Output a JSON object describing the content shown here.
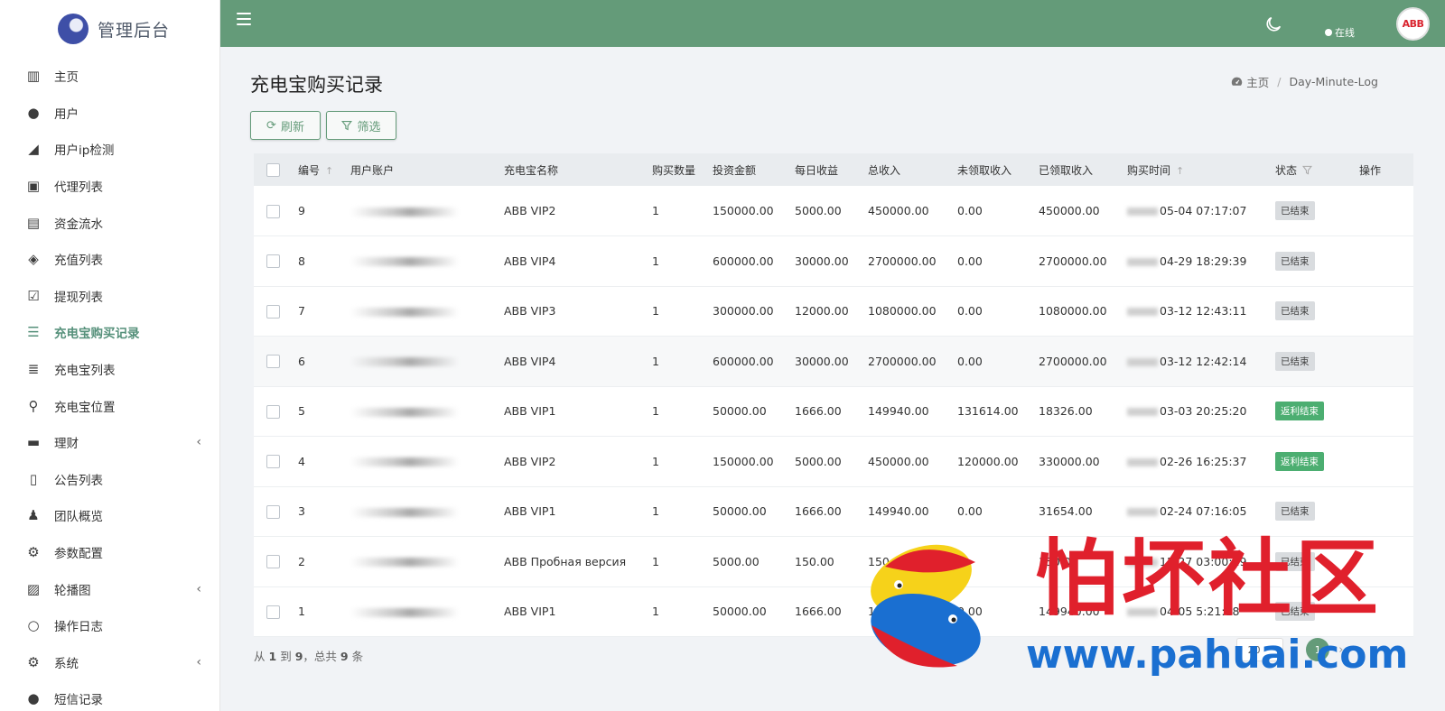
{
  "brand": {
    "title": "管理后台"
  },
  "sidebar": {
    "items": [
      {
        "label": "主页",
        "icon": "bar-chart-icon"
      },
      {
        "label": "用户",
        "icon": "user-icon"
      },
      {
        "label": "用户ip检测",
        "icon": "signal-icon"
      },
      {
        "label": "代理列表",
        "icon": "address-book-icon"
      },
      {
        "label": "资金流水",
        "icon": "money-icon"
      },
      {
        "label": "充值列表",
        "icon": "recharge-icon"
      },
      {
        "label": "提现列表",
        "icon": "check-square-icon"
      },
      {
        "label": "充电宝购买记录",
        "icon": "list-icon",
        "active": true
      },
      {
        "label": "充电宝列表",
        "icon": "indent-list-icon"
      },
      {
        "label": "充电宝位置",
        "icon": "map-marker-icon"
      },
      {
        "label": "理财",
        "icon": "archive-icon",
        "has_submenu": true
      },
      {
        "label": "公告列表",
        "icon": "file-text-icon"
      },
      {
        "label": "团队概览",
        "icon": "users-icon"
      },
      {
        "label": "参数配置",
        "icon": "cogs-icon"
      },
      {
        "label": "轮播图",
        "icon": "image-icon",
        "has_submenu": true
      },
      {
        "label": "操作日志",
        "icon": "circle-icon"
      },
      {
        "label": "系统",
        "icon": "gear-icon",
        "has_submenu": true
      },
      {
        "label": "短信记录",
        "icon": "comment-icon"
      }
    ]
  },
  "topbar": {
    "status_label": "在线",
    "avatar_text": "ABB",
    "theme_icon": "moon-icon"
  },
  "page": {
    "title": "充电宝购买记录",
    "breadcrumb": {
      "home": "主页",
      "current": "Day-Minute-Log"
    }
  },
  "toolbar": {
    "refresh_label": "刷新",
    "filter_label": "筛选"
  },
  "table": {
    "headers": {
      "id": "编号",
      "account": "用户账户",
      "name": "充电宝名称",
      "qty": "购买数量",
      "invest": "投资金额",
      "daily": "每日收益",
      "total": "总收入",
      "unclaimed": "未领取收入",
      "claimed": "已领取收入",
      "time": "购买时间",
      "status": "状态",
      "action": "操作"
    },
    "rows": [
      {
        "id": "9",
        "name": "ABB VIP2",
        "qty": "1",
        "invest": "150000.00",
        "daily": "5000.00",
        "total": "450000.00",
        "unclaimed": "0.00",
        "claimed": "450000.00",
        "time": "05-04 07:17:07",
        "status": "已结束",
        "status_type": "gray"
      },
      {
        "id": "8",
        "name": "ABB VIP4",
        "qty": "1",
        "invest": "600000.00",
        "daily": "30000.00",
        "total": "2700000.00",
        "unclaimed": "0.00",
        "claimed": "2700000.00",
        "time": "04-29 18:29:39",
        "status": "已结束",
        "status_type": "gray"
      },
      {
        "id": "7",
        "name": "ABB VIP3",
        "qty": "1",
        "invest": "300000.00",
        "daily": "12000.00",
        "total": "1080000.00",
        "unclaimed": "0.00",
        "claimed": "1080000.00",
        "time": "03-12 12:43:11",
        "status": "已结束",
        "status_type": "gray"
      },
      {
        "id": "6",
        "name": "ABB VIP4",
        "qty": "1",
        "invest": "600000.00",
        "daily": "30000.00",
        "total": "2700000.00",
        "unclaimed": "0.00",
        "claimed": "2700000.00",
        "time": "03-12 12:42:14",
        "status": "已结束",
        "status_type": "gray"
      },
      {
        "id": "5",
        "name": "ABB VIP1",
        "qty": "1",
        "invest": "50000.00",
        "daily": "1666.00",
        "total": "149940.00",
        "unclaimed": "131614.00",
        "claimed": "18326.00",
        "time": "03-03 20:25:20",
        "status": "返利结束",
        "status_type": "green"
      },
      {
        "id": "4",
        "name": "ABB VIP2",
        "qty": "1",
        "invest": "150000.00",
        "daily": "5000.00",
        "total": "450000.00",
        "unclaimed": "120000.00",
        "claimed": "330000.00",
        "time": "02-26 16:25:37",
        "status": "返利结束",
        "status_type": "green"
      },
      {
        "id": "3",
        "name": "ABB VIP1",
        "qty": "1",
        "invest": "50000.00",
        "daily": "1666.00",
        "total": "149940.00",
        "unclaimed": "0.00",
        "claimed": "31654.00",
        "time": "02-24 07:16:05",
        "status": "已结束",
        "status_type": "gray"
      },
      {
        "id": "2",
        "name": "ABB Пробная версия",
        "qty": "1",
        "invest": "5000.00",
        "daily": "150.00",
        "total": "150.00",
        "unclaimed": "",
        "claimed": "150.00",
        "time": "12-27 03:00:19",
        "status": "已结束",
        "status_type": "gray"
      },
      {
        "id": "1",
        "name": "ABB VIP1",
        "qty": "1",
        "invest": "50000.00",
        "daily": "1666.00",
        "total": "149",
        "unclaimed": "0.00",
        "claimed": "149940.00",
        "time": "04-05 5:21:18",
        "status": "已结束",
        "status_type": "gray"
      }
    ]
  },
  "footer": {
    "info_prefix": "从",
    "from": "1",
    "to_label": "到",
    "to": "9",
    "total_label": "，总共",
    "total": "9",
    "unit": "条",
    "page_size": "20",
    "current_page": "1"
  },
  "watermark": {
    "text": "怕坏社区",
    "url": "www.pahuai.com"
  },
  "colors": {
    "accent": "#649b79",
    "status_green": "#4cae71",
    "watermark_red": "#e0202c",
    "watermark_blue": "#1a6fd1"
  }
}
